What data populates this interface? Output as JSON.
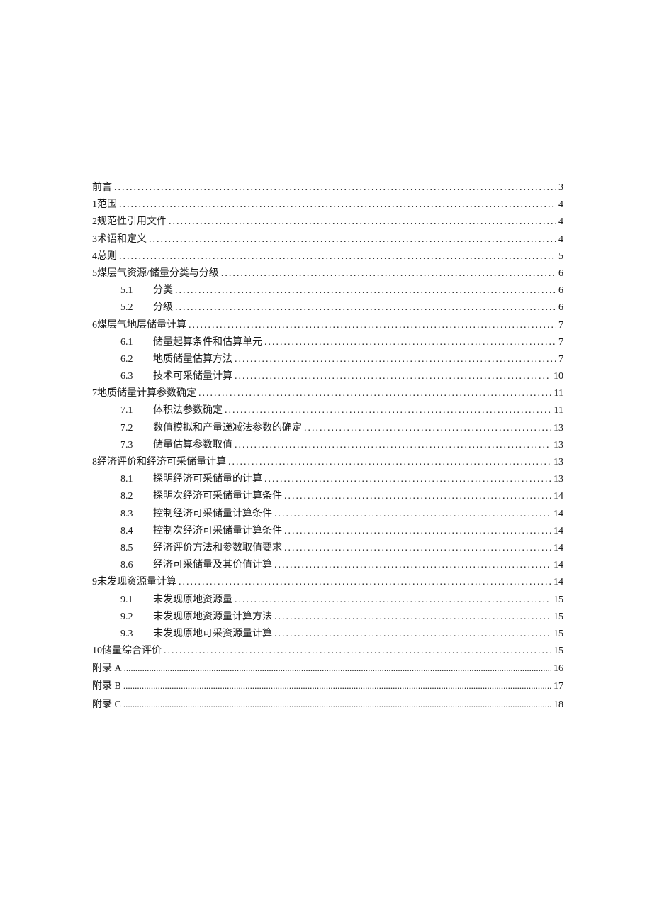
{
  "toc": [
    {
      "level": 1,
      "num": "",
      "label": "前言",
      "page": "3"
    },
    {
      "level": 1,
      "num": "1",
      "label": "范围",
      "page": "4"
    },
    {
      "level": 1,
      "num": "2",
      "label": "规范性引用文件",
      "page": "4"
    },
    {
      "level": 1,
      "num": "3",
      "label": "术语和定义",
      "page": "4"
    },
    {
      "level": 1,
      "num": "4",
      "label": "总则",
      "page": "5"
    },
    {
      "level": 1,
      "num": "5",
      "label": "煤层气资源/储量分类与分级",
      "page": "6"
    },
    {
      "level": 2,
      "num": "5.1",
      "label": "分类",
      "page": "6"
    },
    {
      "level": 2,
      "num": "5.2",
      "label": "分级",
      "page": "6"
    },
    {
      "level": 1,
      "num": "6",
      "label": "煤层气地层储量计算",
      "page": "7"
    },
    {
      "level": 2,
      "num": "6.1",
      "label": "储量起算条件和估算单元",
      "page": "7"
    },
    {
      "level": 2,
      "num": "6.2",
      "label": "地质储量估算方法",
      "page": "7"
    },
    {
      "level": 2,
      "num": "6.3",
      "label": "技术可采储量计算",
      "page": "10"
    },
    {
      "level": 1,
      "num": "7",
      "label": "地质储量计算参数确定",
      "page": "11"
    },
    {
      "level": 2,
      "num": "7.1",
      "label": "体积法参数确定",
      "page": "11"
    },
    {
      "level": 2,
      "num": "7.2",
      "label": "数值模拟和产量递减法参数的确定",
      "page": "13"
    },
    {
      "level": 2,
      "num": "7.3",
      "label": "储量估算参数取值",
      "page": "13"
    },
    {
      "level": 1,
      "num": "8",
      "label": "经济评价和经济可采储量计算",
      "page": "13"
    },
    {
      "level": 2,
      "num": "8.1",
      "label": "探明经济可采储量的计算",
      "page": "13"
    },
    {
      "level": 2,
      "num": "8.2",
      "label": "探明次经济可采储量计算条件",
      "page": "14"
    },
    {
      "level": 2,
      "num": "8.3",
      "label": "控制经济可采储量计算条件",
      "page": "14"
    },
    {
      "level": 2,
      "num": "8.4",
      "label": "控制次经济可采储量计算条件",
      "page": "14"
    },
    {
      "level": 2,
      "num": "8.5",
      "label": "经济评价方法和参数取值要求",
      "page": "14"
    },
    {
      "level": 2,
      "num": "8.6",
      "label": "经济可采储量及其价值计算",
      "page": "14"
    },
    {
      "level": 1,
      "num": "9",
      "label": "未发现资源量计算",
      "page": "14"
    },
    {
      "level": 2,
      "num": "9.1",
      "label": "未发现原地资源量",
      "page": "15"
    },
    {
      "level": 2,
      "num": "9.2",
      "label": "未发现原地资源量计算方法",
      "page": "15"
    },
    {
      "level": 2,
      "num": "9.3",
      "label": "未发现原地可采资源量计算",
      "page": "15"
    },
    {
      "level": 1,
      "num": "10",
      "label": "储量综合评价",
      "page": "15"
    },
    {
      "level": 1,
      "num": "",
      "label": "附录 A",
      "page": "16",
      "fine": true
    },
    {
      "level": 1,
      "num": "",
      "label": "附录 B",
      "page": "17",
      "fine": true
    },
    {
      "level": 1,
      "num": "",
      "label": "附录 C",
      "page": "18",
      "fine": true
    }
  ],
  "dot_seq": "................................................................................................................................................................",
  "fine_dot_seq": "............................................................................................................................................................................................................................................................................................"
}
